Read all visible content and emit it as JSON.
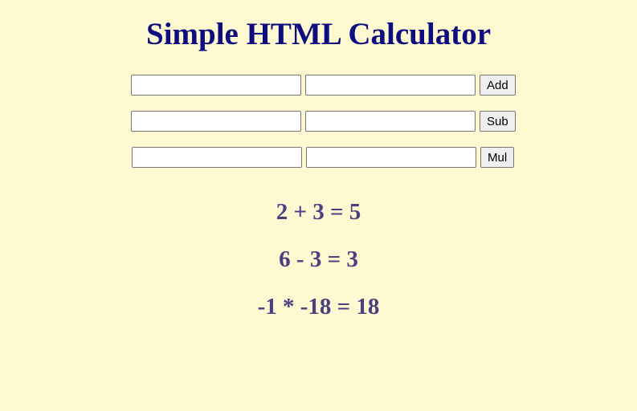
{
  "title": "Simple HTML Calculator",
  "rows": [
    {
      "input1_value": "",
      "input2_value": "",
      "button_label": "Add"
    },
    {
      "input1_value": "",
      "input2_value": "",
      "button_label": "Sub"
    },
    {
      "input1_value": "",
      "input2_value": "",
      "button_label": "Mul"
    }
  ],
  "results": [
    "2 + 3 = 5",
    "6 - 3 = 3",
    "-1 * -18 = 18"
  ],
  "colors": {
    "background": "#fff9d1",
    "title": "#0d0d80",
    "result_text": "#4a4080"
  }
}
